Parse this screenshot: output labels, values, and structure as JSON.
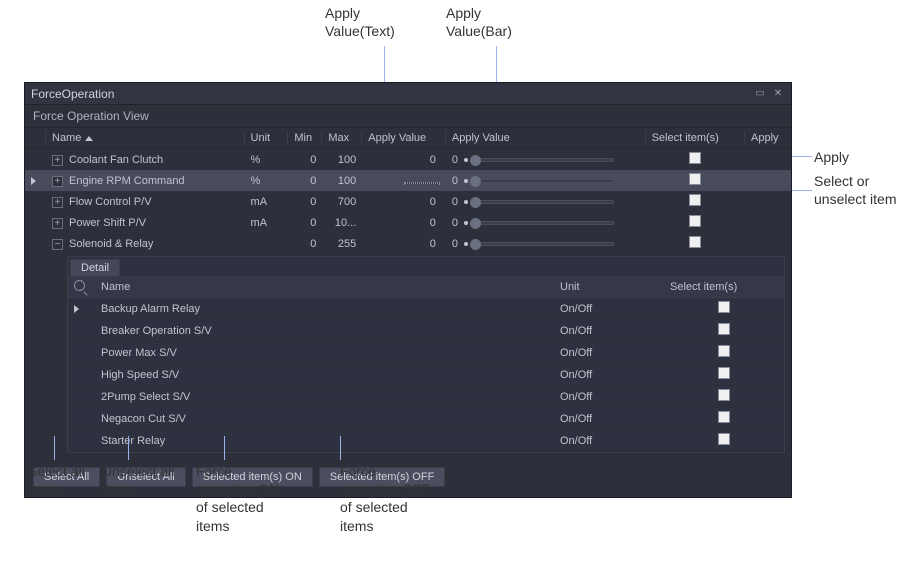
{
  "callouts": {
    "apply_value_text": "Apply\nValue(Text)",
    "apply_value_bar": "Apply\nValue(Bar)",
    "apply_right": "Apply",
    "select_right": "Select  or\nunselect item",
    "select_all_items": "Select all\nitems",
    "unselect_all_items": "Unselect all\nitems",
    "force_on_items": "Force\noperation ON\nof selected\nitems",
    "force_off_items": "Force\noperation OFF\nof selected\nitems"
  },
  "panel": {
    "title": "ForceOperation",
    "subtitle": "Force Operation View"
  },
  "columns": {
    "name": "Name",
    "unit": "Unit",
    "min": "Min",
    "max": "Max",
    "apply_value_text": "Apply Value",
    "apply_value_bar": "Apply Value",
    "select": "Select item(s)",
    "apply": "Apply"
  },
  "rows": [
    {
      "name": "Coolant Fan Clutch",
      "unit": "%",
      "min": "0",
      "max": "100",
      "val_text": "0",
      "bar_val": "0",
      "selected": false,
      "editing": false,
      "expander": "+"
    },
    {
      "name": "Engine RPM Command",
      "unit": "%",
      "min": "0",
      "max": "100",
      "val_text": "",
      "bar_val": "0",
      "selected": true,
      "editing": true,
      "expander": "+"
    },
    {
      "name": "Flow Control P/V",
      "unit": "mA",
      "min": "0",
      "max": "700",
      "val_text": "0",
      "bar_val": "0",
      "selected": false,
      "editing": false,
      "expander": "+"
    },
    {
      "name": "Power Shift P/V",
      "unit": "mA",
      "min": "0",
      "max": "10...",
      "val_text": "0",
      "bar_val": "0",
      "selected": false,
      "editing": false,
      "expander": "+"
    },
    {
      "name": "Solenoid & Relay",
      "unit": "",
      "min": "0",
      "max": "255",
      "val_text": "0",
      "bar_val": "0",
      "selected": false,
      "editing": false,
      "expander": "−"
    }
  ],
  "detail": {
    "tab": "Detail",
    "columns": {
      "name": "Name",
      "unit": "Unit",
      "select": "Select item(s)"
    },
    "rows": [
      {
        "name": "Backup Alarm Relay",
        "unit": "On/Off",
        "arrow": true
      },
      {
        "name": "Breaker Operation S/V",
        "unit": "On/Off",
        "arrow": false
      },
      {
        "name": "Power Max S/V",
        "unit": "On/Off",
        "arrow": false
      },
      {
        "name": "High Speed S/V",
        "unit": "On/Off",
        "arrow": false
      },
      {
        "name": "2Pump Select S/V",
        "unit": "On/Off",
        "arrow": false
      },
      {
        "name": "Negacon Cut S/V",
        "unit": "On/Off",
        "arrow": false
      },
      {
        "name": "Starter Relay",
        "unit": "On/Off",
        "arrow": false
      }
    ]
  },
  "buttons": {
    "select_all": "Select All",
    "unselect_all": "Unselect All",
    "selected_on": "Selected item(s) ON",
    "selected_off": "Selected item(s) OFF"
  }
}
